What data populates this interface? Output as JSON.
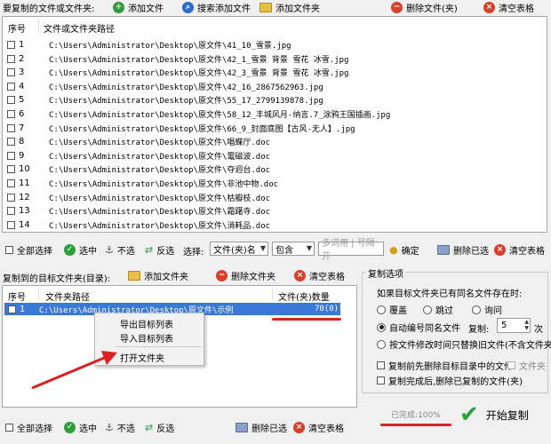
{
  "top_toolbar": {
    "label": "要复制的文件或文件夹:",
    "add_file": "添加文件",
    "search_add_file": "搜索添加文件",
    "add_folder": "添加文件夹",
    "delete_file": "删除文件(夹)",
    "clear_table": "清空表格"
  },
  "source_table": {
    "columns": [
      "序号",
      "文件或文件夹路径"
    ],
    "rows": [
      {
        "no": "1",
        "path": "C:\\Users\\Administrator\\Desktop\\原文件\\41_10_雪景.jpg"
      },
      {
        "no": "2",
        "path": "C:\\Users\\Administrator\\Desktop\\原文件\\42_1_雪景 背景 雪花 冰雪.jpg"
      },
      {
        "no": "3",
        "path": "C:\\Users\\Administrator\\Desktop\\原文件\\42_3_雪景 背景 雪花 冰雪.jpg"
      },
      {
        "no": "4",
        "path": "C:\\Users\\Administrator\\Desktop\\原文件\\42_16_2867562963.jpg"
      },
      {
        "no": "5",
        "path": "C:\\Users\\Administrator\\Desktop\\原文件\\55_17_2799139878.jpg"
      },
      {
        "no": "6",
        "path": "C:\\Users\\Administrator\\Desktop\\原文件\\58_12_丰城风月-纳言.7_涂鸦王国插画.jpg"
      },
      {
        "no": "7",
        "path": "C:\\Users\\Administrator\\Desktop\\原文件\\66_9_封面底图【古风-无人】.jpg"
      },
      {
        "no": "8",
        "path": "C:\\Users\\Administrator\\Desktop\\原文件\\唱蝶厅.doc"
      },
      {
        "no": "9",
        "path": "C:\\Users\\Administrator\\Desktop\\原文件\\電磁波.doc"
      },
      {
        "no": "10",
        "path": "C:\\Users\\Administrator\\Desktop\\原文件\\夺迥台.doc"
      },
      {
        "no": "11",
        "path": "C:\\Users\\Administrator\\Desktop\\原文件\\非池中物.doc"
      },
      {
        "no": "12",
        "path": "C:\\Users\\Administrator\\Desktop\\原文件\\枯瓣枝.doc"
      },
      {
        "no": "13",
        "path": "C:\\Users\\Administrator\\Desktop\\原文件\\霜躇寺.doc"
      },
      {
        "no": "14",
        "path": "C:\\Users\\Administrator\\Desktop\\原文件\\消耗品.doc"
      }
    ]
  },
  "source_actions": {
    "select_all": "全部选择",
    "select": "选中",
    "unselect": "不选",
    "invert": "反选",
    "choose_label": "选择:",
    "field_select": "文件(夹)名",
    "mode_select": "包含",
    "keyword_placeholder": "多词用 | 号隔开",
    "confirm": "确定",
    "delete_selected": "删除已选",
    "clear_table": "清空表格"
  },
  "target_toolbar": {
    "label": "复制到的目标文件夹(目录):",
    "add_folder": "添加文件夹",
    "delete_folder": "删除文件夹",
    "clear_table": "清空表格"
  },
  "target_table": {
    "columns": [
      "序号",
      "文件夹路径",
      "文件(夹)数量"
    ],
    "rows": [
      {
        "no": "1",
        "path": "C:\\Users\\Administrator\\Desktop\\原文件\\示例",
        "count": "70(0)"
      }
    ]
  },
  "context_menu": {
    "items": [
      "导出目标列表",
      "导入目标列表",
      "打开文件夹"
    ]
  },
  "target_actions": {
    "select_all": "全部选择",
    "select": "选中",
    "unselect": "不选",
    "invert": "反选",
    "delete_selected": "删除已选",
    "clear_table": "清空表格"
  },
  "copy_options": {
    "title": "复制选项",
    "question": "如果目标文件夹已有同名文件存在时:",
    "overwrite": "覆盖",
    "skip": "跳过",
    "ask": "询问",
    "auto_number": "自动编号同名文件",
    "copy_label": "复制:",
    "copy_times": "5",
    "times_unit": "次",
    "by_mtime": "按文件修改时间只替换旧文件(不含文件夹)",
    "clear_before": "复制前先删除目标目录中的文件",
    "folder_option": "文件夹",
    "delete_after": "复制完成后,删除已复制的文件(夹)"
  },
  "status": {
    "progress_text": "已完成:100%",
    "progress": 1.0,
    "start_copy": "开始复制"
  }
}
